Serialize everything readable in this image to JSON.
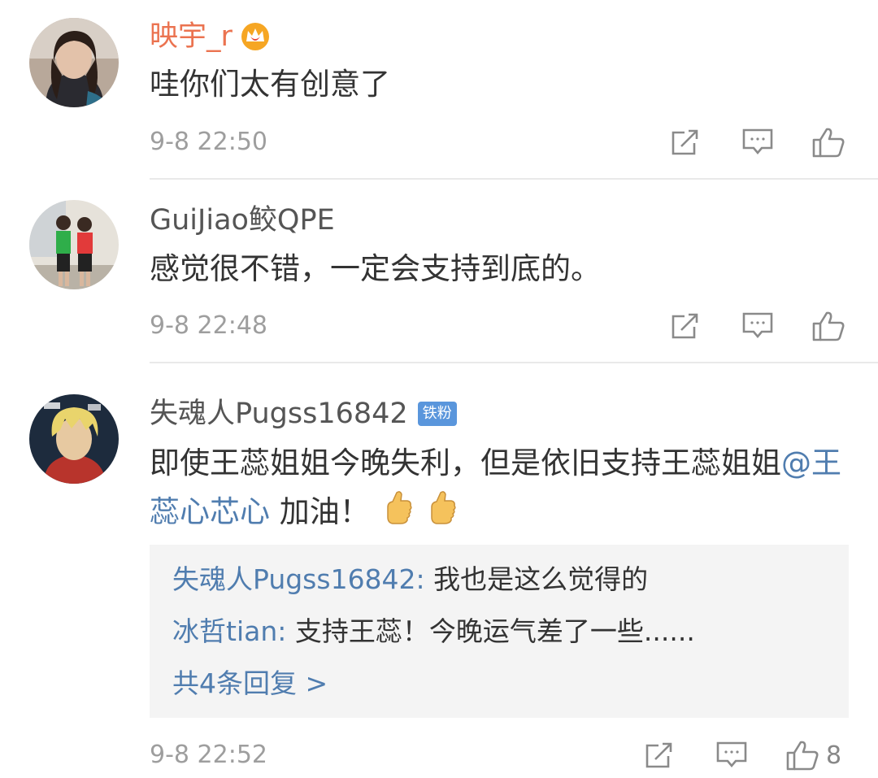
{
  "comments": [
    {
      "username": "映宇_r",
      "text": "哇你们太有创意了",
      "time": "9-8 22:50",
      "icons": [
        "share-icon",
        "comment-icon",
        "like-icon"
      ]
    },
    {
      "username": "GuiJiao鲛QPE",
      "text": "感觉很不错，一定会支持到底的。",
      "time": "9-8 22:48",
      "icons": [
        "share-icon",
        "comment-icon",
        "like-icon"
      ]
    },
    {
      "username": "失魂人Pugss16842",
      "badge": "铁粉",
      "text_before": "即使王蕊姐姐今晚失利，但是依旧支持王蕊姐姐",
      "mention": "@王蕊心芯心",
      "text_after": " 加油！",
      "emoji": [
        "thumbs-up-emoji",
        "thumbs-up-emoji"
      ],
      "replies": [
        {
          "user": "失魂人Pugss16842:",
          "text": " 我也是这么觉得的"
        },
        {
          "user": "冰哲tian:",
          "text": " 支持王蕊！今晚运气差了一些......"
        }
      ],
      "more_replies": "共4条回复 >",
      "time": "9-8 22:52",
      "like_count": "8",
      "icons": [
        "share-icon",
        "comment-icon",
        "like-icon"
      ]
    }
  ]
}
